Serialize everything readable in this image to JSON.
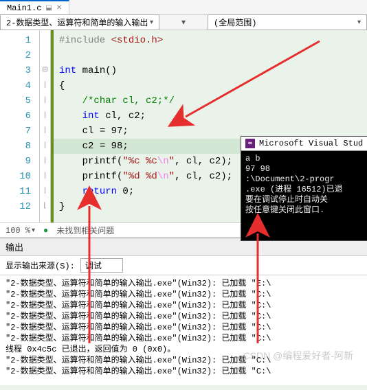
{
  "tab": {
    "filename": "Main1.c",
    "pin": "⬓",
    "close": "×"
  },
  "toolbar": {
    "file_dropdown": "2-数据类型、运算符和简单的输入输出",
    "scope": "(全局范围)"
  },
  "lines": [
    "1",
    "2",
    "3",
    "4",
    "5",
    "6",
    "7",
    "8",
    "9",
    "10",
    "11",
    "12"
  ],
  "code": {
    "l1_pp": "#include ",
    "l1_inc": "<stdio.h>",
    "l3_kw": "int",
    "l3_fn": " main()",
    "l4": "{",
    "l5_cm": "/*char cl, c2;*/",
    "l6_kw": "int",
    "l6_rest": " cl, c2;",
    "l7": "cl = 97;",
    "l8": "c2 = 98;",
    "l9a": "printf(",
    "l9s": "\"%c %c",
    "l9e": "\\n",
    "l9s2": "\"",
    "l9b": ", cl, c2);",
    "l10a": "printf(",
    "l10s": "\"%d %d",
    "l10e": "\\n",
    "l10s2": "\"",
    "l10b": ", cl, c2);",
    "l11_kw": "return",
    "l11_rest": " 0;",
    "l12": "}"
  },
  "footer": {
    "zoom": "100 %",
    "status": "未找到相关问题"
  },
  "output": {
    "header": "输出",
    "src_label": "显示输出来源(S):",
    "src_value": "调试",
    "lines": [
      "\"2-数据类型、运算符和简单的输入输出.exe\"(Win32):  已加载 \"E:\\",
      "\"2-数据类型、运算符和简单的输入输出.exe\"(Win32):  已加载 \"C:\\",
      "\"2-数据类型、运算符和简单的输入输出.exe\"(Win32):  已加载 \"C:\\",
      "\"2-数据类型、运算符和简单的输入输出.exe\"(Win32):  已加载 \"C:\\",
      "\"2-数据类型、运算符和简单的输入输出.exe\"(Win32):  已加载 \"C:\\",
      "\"2-数据类型、运算符和简单的输入输出.exe\"(Win32):  已加载 \"C:\\",
      "线程 0x4c5c 已退出，返回值为 0 (0x0)。",
      "\"2-数据类型、运算符和简单的输入输出.exe\"(Win32):  已加载 \"C:\\",
      "\"2-数据类型、运算符和简单的输入输出.exe\"(Win32):  已加载 \"C:\\"
    ]
  },
  "console": {
    "title": "Microsoft Visual Stud",
    "icon": "⊞",
    "lines": [
      "a b",
      "97 98",
      "",
      ":\\Document\\2-progr",
      ".exe (进程 16512)已退",
      "要在调试停止时自动关",
      "按任意键关闭此窗口."
    ]
  },
  "watermark": "CSDN @编程爱好者-阿新",
  "colors": {
    "arrow": "#e62e2e"
  }
}
